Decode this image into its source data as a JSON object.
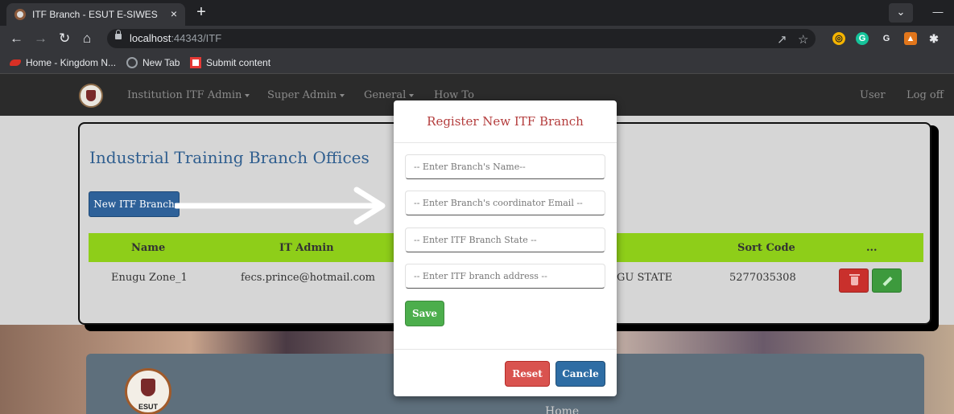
{
  "browser": {
    "tab_title": "ITF Branch - ESUT E-SIWES",
    "tab_close": "×",
    "new_tab": "+",
    "url_host": "localhost",
    "url_path": ":44343/ITF",
    "bookmarks": [
      {
        "label": "Home - Kingdom N..."
      },
      {
        "label": "New Tab"
      },
      {
        "label": "Submit content"
      }
    ]
  },
  "nav": {
    "items": [
      {
        "label": "Institution ITF Admin"
      },
      {
        "label": "Super Admin"
      },
      {
        "label": "General"
      },
      {
        "label": "How To"
      }
    ],
    "user": "User",
    "logoff": "Log off"
  },
  "panel": {
    "title": "Industrial Training Branch Offices",
    "new_button": "New ITF Branch",
    "columns": {
      "name": "Name",
      "it_admin": "IT Admin",
      "sort_code": "Sort Code",
      "actions": "..."
    },
    "rows": [
      {
        "name": "Enugu Zone_1",
        "it_admin": "fecs.prince@hotmail.com",
        "state": "GU STATE",
        "sort_code": "5277035308"
      }
    ]
  },
  "footer": {
    "logo_text": "ESUT",
    "home": "Home"
  },
  "modal": {
    "title": "Register New ITF Branch",
    "fields": {
      "name_placeholder": "-- Enter Branch's Name--",
      "email_placeholder": "-- Enter Branch's coordinator Email --",
      "state_placeholder": "-- Enter ITF Branch State --",
      "address_placeholder": "-- Enter ITF branch address --"
    },
    "save": "Save",
    "reset": "Reset",
    "cancel": "Cancle"
  },
  "colors": {
    "accent_blue": "#2e6199",
    "table_header_green": "#8ece19",
    "modal_title_red": "#b43d3d",
    "save_green": "#4cae4c",
    "reset_red": "#d9534f",
    "cancel_blue": "#2e6da4"
  }
}
